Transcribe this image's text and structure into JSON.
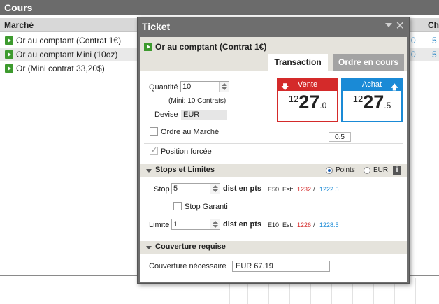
{
  "cours": {
    "title": "Cours",
    "column_marche": "Marché",
    "column_ch": "Ch",
    "rows": [
      {
        "name": "Or au comptant (Contrat 1€)",
        "value": "5",
        "value2": "0"
      },
      {
        "name": "Or au comptant Mini (10oz)",
        "value": "5",
        "value2": "0"
      },
      {
        "name": "Or (Mini contrat 33,20$)",
        "value": "",
        "value2": ""
      }
    ]
  },
  "ticket": {
    "title": "Ticket",
    "instrument": "Or au comptant (Contrat 1€)",
    "tabs": {
      "transaction": "Transaction",
      "ordre": "Ordre en cours"
    },
    "quantite_label": "Quantité",
    "quantite_value": "10",
    "min_note": "(Mini: 10 Contrats)",
    "devise_label": "Devise",
    "devise_value": "EUR",
    "ordre_marche_label": "Ordre au Marché",
    "position_forcee_label": "Position forcée",
    "vente": {
      "label": "Vente",
      "small": "12",
      "big": "27",
      "end": ".0"
    },
    "achat": {
      "label": "Achat",
      "small": "12",
      "big": "27",
      "end": ".5"
    },
    "spread": "0.5",
    "stops": {
      "title": "Stops et Limites",
      "points_label": "Points",
      "eur_label": "EUR",
      "info": "i",
      "stop_label": "Stop",
      "stop_value": "5",
      "dist_label": "dist en pts",
      "stop_code": "E50",
      "est_label": "Est:",
      "stop_est_sell": "1232",
      "sep": "/",
      "stop_est_buy": "1222.5",
      "stop_garanti_label": "Stop Garanti",
      "limite_label": "Limite",
      "limite_value": "1",
      "limite_code": "E10",
      "limite_est_sell": "1226",
      "limite_est_buy": "1228.5"
    },
    "couverture": {
      "title": "Couverture requise",
      "label": "Couverture nécessaire",
      "value": "EUR 67.19"
    }
  },
  "colors": {
    "vente": "#d42a2a",
    "achat": "#1a8ad6",
    "play": "#3d9a2e"
  }
}
